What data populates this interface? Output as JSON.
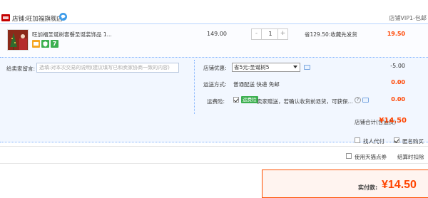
{
  "store": {
    "label": "店铺:",
    "name": "旺加福旗舰店",
    "vip_text": "店铺VIP1-包邮"
  },
  "item": {
    "title": "旺加福圣诞树套餐圣诞装饰品 1...",
    "unit_price": "149.00",
    "quantity": "1",
    "qty_minus": "-",
    "qty_plus": "+",
    "promo": "省129.50:收藏先发货",
    "subtotal": "19.50",
    "badge_text": "7"
  },
  "message": {
    "label": "给卖家留言:",
    "placeholder": "选填:对本次交易的说明(建议填写已和卖家协商一致的内容)"
  },
  "discount": {
    "label": "店铺优惠:",
    "selected": "省5元:圣诞树5",
    "value": "-5.00"
  },
  "shipping": {
    "label": "运送方式:",
    "text": "普通配送 快递 免邮",
    "value": "0.00"
  },
  "insurance": {
    "label": "运费险:",
    "badge": "运费险",
    "text": "卖家赠送，若确认收货前退货，可获保...",
    "value": "0.00"
  },
  "store_total": {
    "label": "店铺合计(含运费)",
    "value": "¥14.50"
  },
  "options": {
    "pay_for_other": "找人代付",
    "anonymous": "匿名购买",
    "use_coupon": "使用天猫点券",
    "settle_time": "结算时扣除"
  },
  "final": {
    "label": "实付款:",
    "value": "¥14.50"
  },
  "colors": {
    "accent": "#ff4400",
    "store_logo": "#c40000",
    "options_bg": "#f2f7ff",
    "insure_badge": "#3caf50"
  }
}
